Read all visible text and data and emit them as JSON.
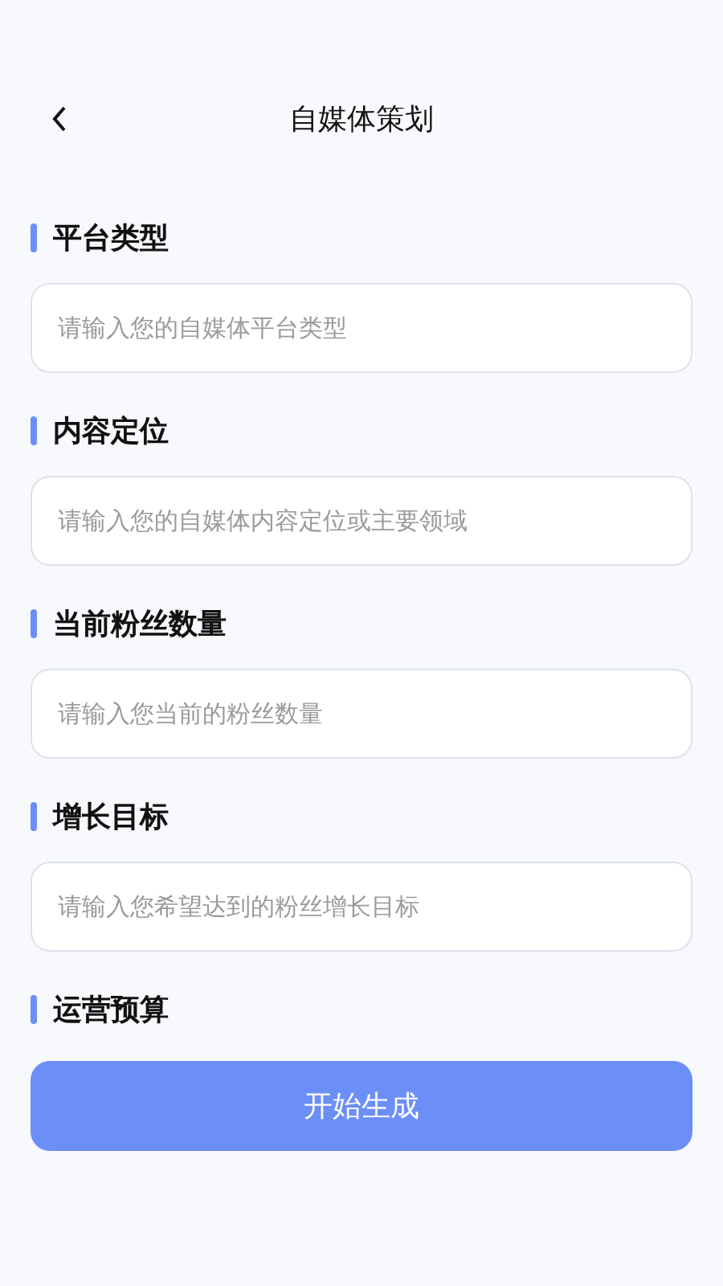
{
  "header": {
    "title": "自媒体策划"
  },
  "fields": [
    {
      "kind": "input",
      "label": "平台类型",
      "placeholder": "请输入您的自媒体平台类型"
    },
    {
      "kind": "input",
      "label": "内容定位",
      "placeholder": "请输入您的自媒体内容定位或主要领域"
    },
    {
      "kind": "input",
      "label": "当前粉丝数量",
      "placeholder": "请输入您当前的粉丝数量"
    },
    {
      "kind": "input",
      "label": "增长目标",
      "placeholder": "请输入您希望达到的粉丝增长目标"
    },
    {
      "kind": "label",
      "label": "运营预算"
    }
  ],
  "submit_button": "开始生成"
}
